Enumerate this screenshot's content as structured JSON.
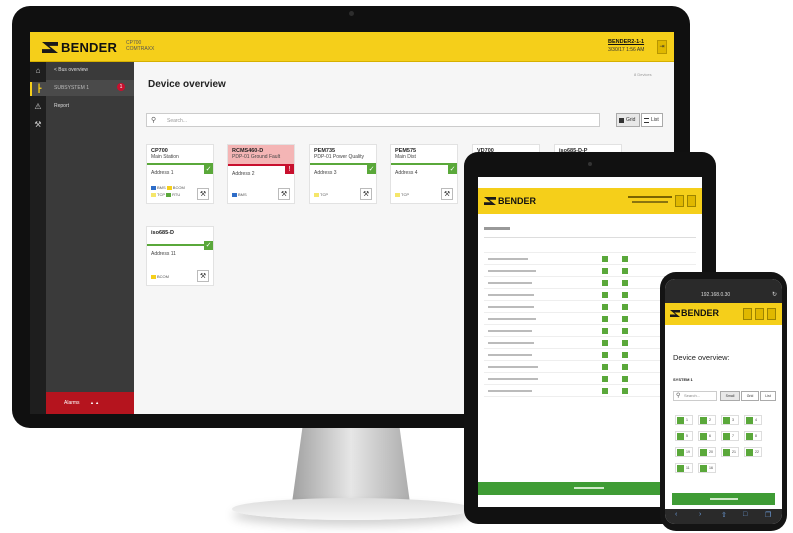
{
  "monitor": {
    "brand": "BENDER",
    "product": "CP700",
    "product_sub": "COMTRAXX",
    "device_name": "BENDER2-1-1",
    "datetime": "3/30/17 1:56 AM",
    "sidebar": {
      "back": "< Bus overview",
      "subsystem": "SUBSYSTEM 1",
      "subsystem_badge": "1",
      "report": "Report",
      "alarms": "Alarms"
    },
    "page_title": "Device overview",
    "device_count": "8 Devices",
    "search_placeholder": "Search...",
    "view_grid": "Grid",
    "view_list": "List",
    "cards": [
      {
        "name": "CP700",
        "sub": "Main Station",
        "addr": "Address 1",
        "tags": [
          "BMS",
          "BCOM",
          "TCP",
          "RTU"
        ],
        "alarm": false
      },
      {
        "name": "RCMS460-D",
        "sub": "PDP-01 Ground Fault",
        "addr": "Address 2",
        "tags": [
          "BMS"
        ],
        "alarm": true
      },
      {
        "name": "PEM735",
        "sub": "PDP-01 Power Quality",
        "addr": "Address 3",
        "tags": [
          "TCP"
        ],
        "alarm": false
      },
      {
        "name": "PEM575",
        "sub": "Main Dist",
        "addr": "Address 4",
        "tags": [
          "TCP"
        ],
        "alarm": false
      },
      {
        "name": "VD700",
        "sub": "",
        "addr": "",
        "tags": [],
        "alarm": false
      },
      {
        "name": "iso685-D-P",
        "sub": "",
        "addr": "",
        "tags": [],
        "alarm": false
      },
      {
        "name": "iso685-D",
        "sub": "",
        "addr": "Address 11",
        "tags": [
          "BCOM"
        ],
        "alarm": false
      }
    ],
    "colors": {
      "accent": "#f5cf1a",
      "ok": "#5aa83a",
      "alarm": "#c8102e"
    }
  },
  "tablet": {
    "brand": "BENDER"
  },
  "phone": {
    "url": "192.168.0.30",
    "brand": "BENDER",
    "title": "Device overview:",
    "system": "SYSTEM 1",
    "search_placeholder": "Search...",
    "view_small": "Small",
    "view_grid": "Grid",
    "view_list": "List",
    "tiles": [
      "1",
      "2",
      "3",
      "4",
      "5",
      "6",
      "7",
      "8",
      "19",
      "20",
      "21",
      "22",
      "11",
      "16"
    ]
  }
}
